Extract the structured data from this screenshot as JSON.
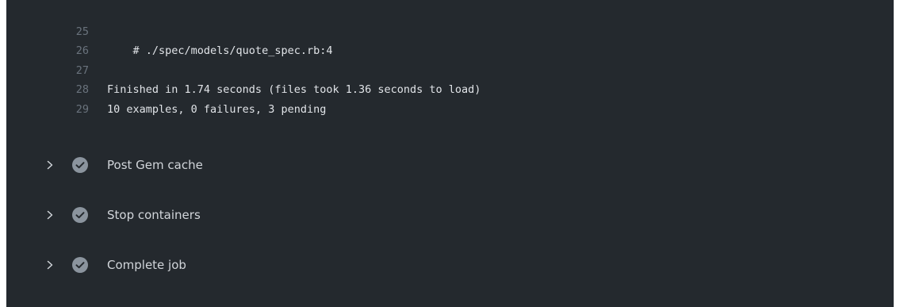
{
  "log": {
    "lines": [
      {
        "number": "25",
        "text": "    # ./spec/models/quote_spec.rb:4"
      },
      {
        "number": "26",
        "text": ""
      },
      {
        "number": "27",
        "text": "Finished in 1.74 seconds (files took 1.36 seconds to load)"
      },
      {
        "number": "28",
        "text": "10 examples, 0 failures, 3 pending"
      },
      {
        "number": "29",
        "text": ""
      }
    ]
  },
  "steps": [
    {
      "label": "Post Gem cache",
      "status": "success",
      "expand_icon": "chevron-right-icon",
      "status_icon": "check-circle-icon"
    },
    {
      "label": "Stop containers",
      "status": "success",
      "expand_icon": "chevron-right-icon",
      "status_icon": "check-circle-icon"
    },
    {
      "label": "Complete job",
      "status": "success",
      "expand_icon": "chevron-right-icon",
      "status_icon": "check-circle-icon"
    }
  ],
  "colors": {
    "background": "#24292e",
    "line_number": "#6a737d",
    "log_text": "#e1e4e8",
    "step_text": "#d1d5da",
    "check_icon": "#8b949e"
  }
}
